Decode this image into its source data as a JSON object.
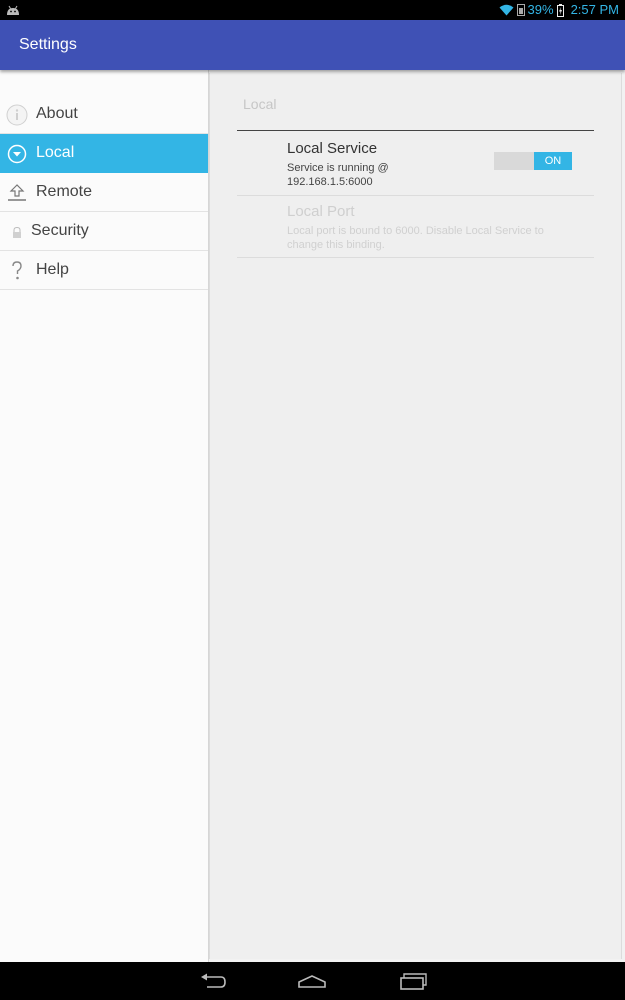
{
  "status_bar": {
    "battery": "39%",
    "time": "2:57 PM",
    "icons": [
      "android-icon",
      "wifi-icon",
      "signal-icon",
      "battery-icon"
    ]
  },
  "action_bar": {
    "title": "Settings"
  },
  "sidebar": {
    "items": [
      {
        "label": "About",
        "icon": "info-icon",
        "selected": false
      },
      {
        "label": "Local",
        "icon": "download-circle-icon",
        "selected": true
      },
      {
        "label": "Remote",
        "icon": "upload-icon",
        "selected": false
      },
      {
        "label": "Security",
        "icon": "lock-icon",
        "selected": false
      },
      {
        "label": "Help",
        "icon": "question-icon",
        "selected": false
      }
    ]
  },
  "detail": {
    "category": "Local",
    "local_service": {
      "title": "Local Service",
      "summary": "Service is running @ 192.168.1.5:6000",
      "toggle": "ON"
    },
    "local_port": {
      "title": "Local Port",
      "summary": "Local port is bound to 6000. Disable Local Service to change this binding."
    }
  },
  "nav_bar": {
    "buttons": [
      "back-icon",
      "home-icon",
      "recents-icon"
    ]
  },
  "colors": {
    "accent": "#33b5e5",
    "action_bar": "#3f51b5"
  }
}
